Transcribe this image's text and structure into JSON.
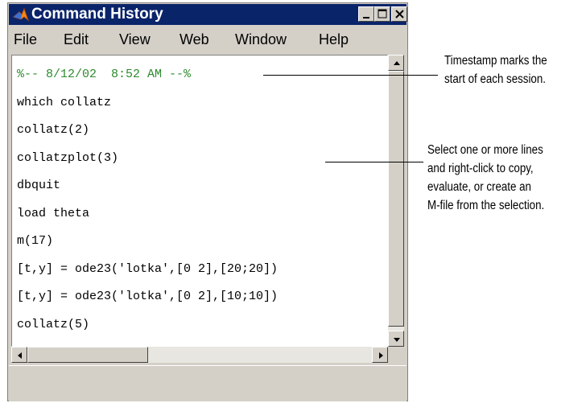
{
  "window": {
    "title": "Command History",
    "menu": [
      "File",
      "Edit",
      "View",
      "Web",
      "Window",
      "Help"
    ],
    "history": [
      "%-- 8/12/02  8:52 AM --%",
      "which collatz",
      "collatz(2)",
      "collatzplot(3)",
      "dbquit",
      "load theta",
      "m(17)",
      "[t,y] = ode23('lotka',[0 2],[20;20])",
      "[t,y] = ode23('lotka',[0 2],[10;10])",
      "collatz(5)"
    ]
  },
  "callouts": {
    "timestamp": [
      "Timestamp marks the",
      "start of each session."
    ],
    "select": [
      "Select one or more lines",
      "and right-click to copy,",
      "evaluate, or create an",
      "M-file from the selection."
    ]
  },
  "colors": {
    "titlebar": "#0a246a",
    "timestamp_text": "#2e8b2e",
    "window_bg": "#d4d0c8"
  },
  "icons": {
    "app": "matlab-logo-icon",
    "minimize": "minimize-icon",
    "maximize": "maximize-icon",
    "close": "close-icon"
  }
}
